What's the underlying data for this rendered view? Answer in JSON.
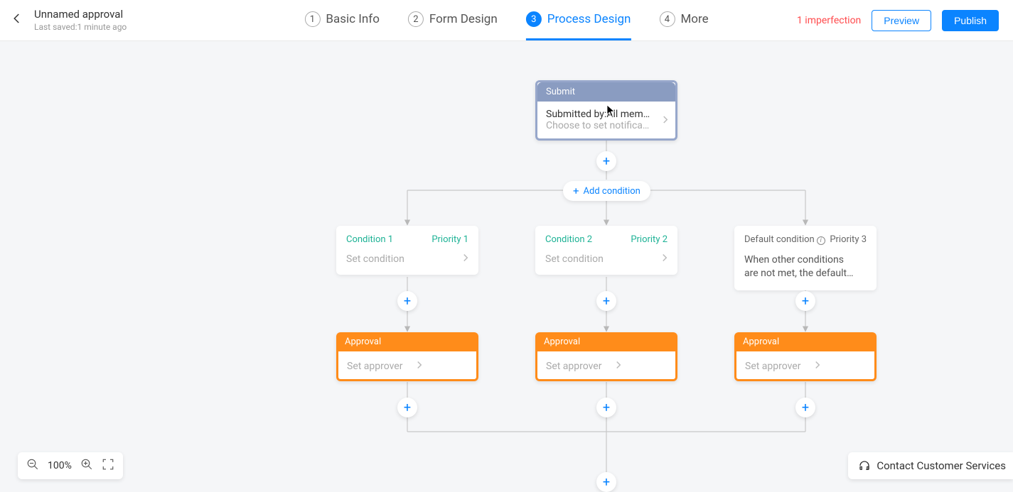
{
  "header": {
    "title": "Unnamed approval",
    "lastSaved": "Last saved:1 minute ago",
    "tabs": [
      {
        "n": "1",
        "label": "Basic Info"
      },
      {
        "n": "2",
        "label": "Form Design"
      },
      {
        "n": "3",
        "label": "Process Design"
      },
      {
        "n": "4",
        "label": "More"
      }
    ],
    "imperfection": "1 imperfection",
    "preview": "Preview",
    "publish": "Publish"
  },
  "submit": {
    "header": "Submit",
    "line1": "Submitted by:All mem…",
    "line2": "Choose to set notifica…"
  },
  "addCondition": "Add condition",
  "conditions": [
    {
      "name": "Condition 1",
      "priority": "Priority 1",
      "body": "Set condition"
    },
    {
      "name": "Condition 2",
      "priority": "Priority 2",
      "body": "Set condition"
    },
    {
      "name": "Default condition",
      "priority": "Priority 3",
      "body": "When other conditions are not met, the default…"
    }
  ],
  "approval": {
    "header": "Approval",
    "placeholder": "Set approver"
  },
  "zoom": "100%",
  "contact": "Contact Customer Services"
}
